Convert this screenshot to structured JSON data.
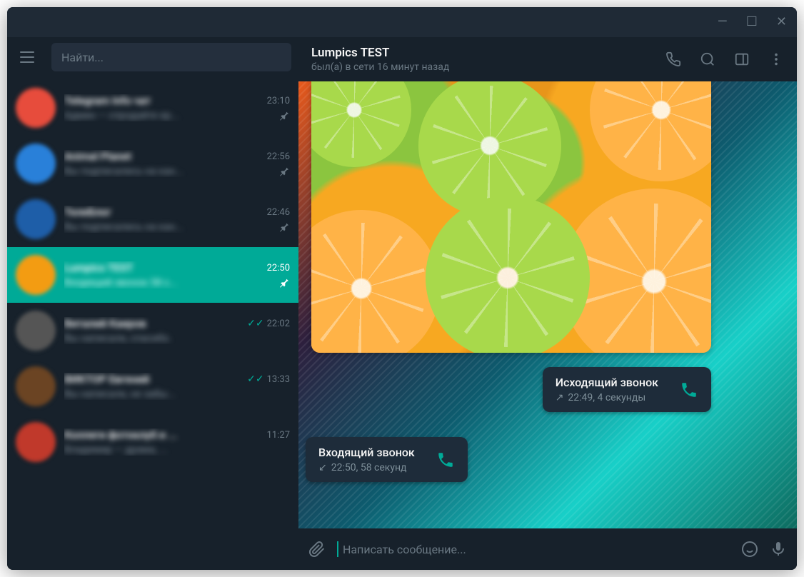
{
  "search": {
    "placeholder": "Найти..."
  },
  "header": {
    "title": "Lumpics TEST",
    "status": "был(а) в сети 16 минут назад"
  },
  "chats": [
    {
      "name": "Telegram Info чат",
      "time": "23:10",
      "preview": "Админ — спродайте ер...",
      "pinned": true,
      "avatar": "#e74c3c"
    },
    {
      "name": "Animal Planet",
      "time": "22:56",
      "preview": "Вы подписались на кан...",
      "pinned": true,
      "avatar": "#2980d9"
    },
    {
      "name": "ТелеБлог",
      "time": "22:46",
      "preview": "Вы подписались на кан...",
      "pinned": true,
      "avatar": "#1e5ea8"
    },
    {
      "name": "Lumpics TEST",
      "time": "22:50",
      "preview": "Входящий звонок 58 с...",
      "pinned": true,
      "avatar": "#f39c12",
      "selected": true
    },
    {
      "name": "Виталий Каиров",
      "time": "22:02",
      "preview": "Вы написали, спасибо.",
      "checks": true,
      "avatar": "#555"
    },
    {
      "name": "ВИКТОР Евгений",
      "time": "13:33",
      "preview": "Вы написали, не забы...",
      "checks": true,
      "avatar": "#6b4423"
    },
    {
      "name": "Коллеги фотоклуб и ...",
      "time": "11:27",
      "preview": "Владимир — драма, ...",
      "avatar": "#c0392b"
    }
  ],
  "calls": {
    "outgoing": {
      "title": "Исходящий звонок",
      "time": "22:49, 4 секунды"
    },
    "incoming": {
      "title": "Входящий звонок",
      "time": "22:50, 58 секунд"
    }
  },
  "composer": {
    "placeholder": "Написать сообщение..."
  }
}
